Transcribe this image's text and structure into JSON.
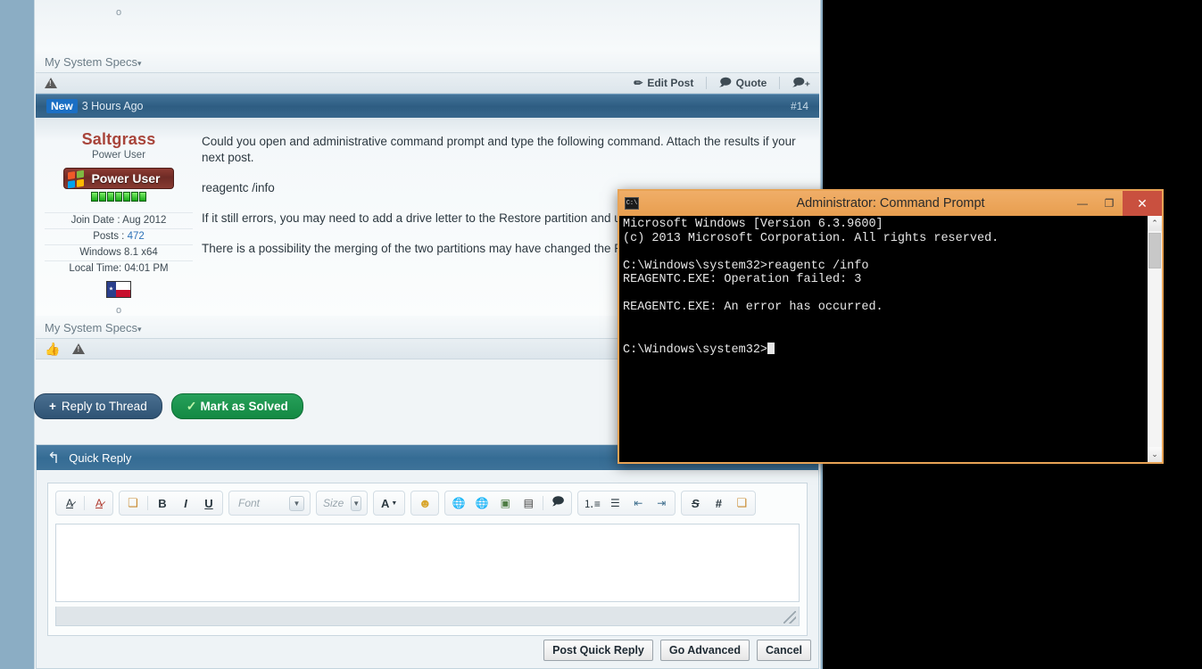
{
  "page": {
    "background_color": "#8badc4",
    "content_bg": "#f1f5f7"
  },
  "top_post": {
    "specs_label": "My System Specs",
    "caret": "▾",
    "edit_label": "Edit Post",
    "quote_label": "Quote",
    "dot": "o"
  },
  "post": {
    "badge": "New",
    "time": "3 Hours Ago",
    "number": "#14",
    "user": {
      "name": "Saltgrass",
      "title": "Power User",
      "rank_badge": "Power User",
      "pip_count": 7,
      "join_date": "Join Date : Aug 2012",
      "posts_label": "Posts :",
      "posts_count": "472",
      "os": "Windows 8.1 x64",
      "local_time": "Local Time: 04:01 PM",
      "dot": "o"
    },
    "paragraphs": [
      "Could you open and administrative command prompt and type the following command. Attach the results if your next post.",
      "reagentc /info",
      "If it still errors, you may need to add a drive letter to the Restore partition and use it as a path to the image.",
      "There is a possibility the merging of the two partitions may have changed the Restore partition."
    ],
    "specs_label": "My System Specs",
    "caret": "▾"
  },
  "actions": {
    "reply_label": "Reply to Thread",
    "reply_plus": "+",
    "solved_label": "Mark as Solved",
    "solved_check": "✓"
  },
  "quick_reply": {
    "title": "Quick Reply",
    "toolbar": [
      {
        "name": "remove-formatting-icon",
        "glyph": "A̶"
      },
      {
        "name": "undo-formatting-icon",
        "glyph": "A̶"
      },
      {
        "name": "paste-icon",
        "glyph": "📋"
      },
      {
        "name": "bold-icon",
        "glyph": "B"
      },
      {
        "name": "italic-icon",
        "glyph": "I"
      },
      {
        "name": "underline-icon",
        "glyph": "U"
      },
      {
        "name": "font-select",
        "glyph": "Font"
      },
      {
        "name": "size-select",
        "glyph": "Size"
      },
      {
        "name": "text-color-icon",
        "glyph": "A"
      },
      {
        "name": "smilie-icon",
        "glyph": "☺"
      },
      {
        "name": "insert-link-icon",
        "glyph": "🌐"
      },
      {
        "name": "unlink-icon",
        "glyph": "🌐"
      },
      {
        "name": "insert-image-icon",
        "glyph": "🖼"
      },
      {
        "name": "insert-video-icon",
        "glyph": "🎞"
      },
      {
        "name": "quote-icon",
        "glyph": "💬"
      },
      {
        "name": "ordered-list-icon",
        "glyph": "≡"
      },
      {
        "name": "unordered-list-icon",
        "glyph": "≣"
      },
      {
        "name": "outdent-icon",
        "glyph": "⇤"
      },
      {
        "name": "indent-icon",
        "glyph": "⇥"
      },
      {
        "name": "strikethrough-icon",
        "glyph": "S"
      },
      {
        "name": "code-icon",
        "glyph": "#"
      },
      {
        "name": "paste-special-icon",
        "glyph": "📋"
      }
    ],
    "font_placeholder": "Font",
    "size_placeholder": "Size",
    "message_value": "",
    "buttons": {
      "post": "Post Quick Reply",
      "advanced": "Go Advanced",
      "cancel": "Cancel"
    }
  },
  "cmd_window": {
    "title": "Administrator: Command Prompt",
    "icon_label": "C:\\",
    "minimize": "—",
    "maximize": "❐",
    "close": "✕",
    "scroll_up": "⌃",
    "scroll_down": "⌄",
    "lines": [
      "Microsoft Windows [Version 6.3.9600]",
      "(c) 2013 Microsoft Corporation. All rights reserved.",
      "",
      "C:\\Windows\\system32>reagentc /info",
      "REAGENTC.EXE: Operation failed: 3",
      "",
      "REAGENTC.EXE: An error has occurred.",
      "",
      "",
      "C:\\Windows\\system32>"
    ]
  }
}
